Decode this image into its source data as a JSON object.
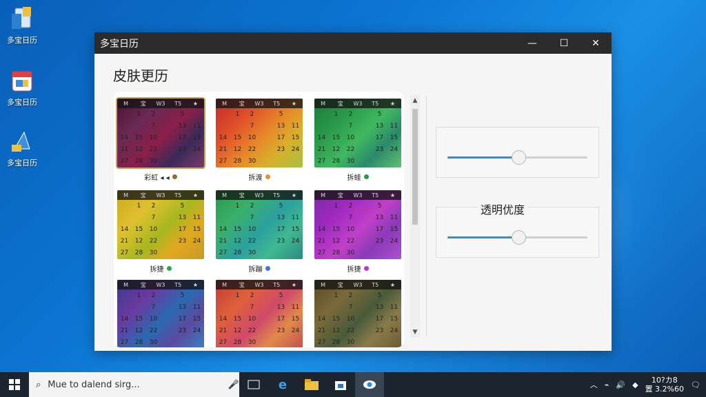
{
  "desktop": {
    "icons": [
      {
        "label": "多宝日历",
        "icon": "recycle-bin-icon"
      },
      {
        "label": "多宝日历",
        "icon": "calendar-app-icon"
      },
      {
        "label": "多宝日历",
        "icon": "network-icon"
      }
    ]
  },
  "window": {
    "title": "多宝日历",
    "controls": {
      "minimize": "—",
      "maximize": "☐",
      "close": "✕"
    },
    "heading": "皮肤更历",
    "skins": [
      {
        "label": "彩虹 ◂ ◂",
        "dot": "#8a6e2a",
        "selected": true,
        "colors": [
          "#4a1230",
          "#6a2a55",
          "#8a1f4a",
          "#3a2a5a",
          "#7a3a6a",
          "#a0506a"
        ]
      },
      {
        "label": "拆渡",
        "dot": "#f08a2a",
        "selected": false,
        "colors": [
          "#c02a2a",
          "#e0502a",
          "#e8882a",
          "#d8b02a",
          "#a8c040",
          "#e06a30"
        ]
      },
      {
        "label": "拆蛙",
        "dot": "#2a9a4a",
        "selected": false,
        "colors": [
          "#1a7a3a",
          "#2a9a4a",
          "#40b860",
          "#2a8a6a",
          "#60c070",
          "#1a6a4a"
        ]
      },
      {
        "label": "拆捷",
        "dot": "#2aa84a",
        "selected": false,
        "colors": [
          "#c8a820",
          "#e0c030",
          "#a8b820",
          "#e0a820",
          "#c89a28",
          "#b8c040"
        ]
      },
      {
        "label": "拆蹦",
        "dot": "#3a7ad8",
        "selected": false,
        "colors": [
          "#2a9a4a",
          "#3ab06a",
          "#2aa0a0",
          "#40b890",
          "#2a8a80",
          "#50c0a0"
        ]
      },
      {
        "label": "拆捷",
        "dot": "#c03ac0",
        "selected": false,
        "colors": [
          "#7a2aa0",
          "#a02ac0",
          "#c040c8",
          "#8a3ab8",
          "#b050d0",
          "#e060c0"
        ]
      },
      {
        "label": "—",
        "dot": "",
        "selected": false,
        "colors": [
          "#3a3a8a",
          "#6a3aa0",
          "#2a6ab0",
          "#5a4aa0",
          "#3a80c0",
          "#7a5ab0"
        ]
      },
      {
        "label": "—",
        "dot": "",
        "selected": false,
        "colors": [
          "#c03a3a",
          "#e0603a",
          "#d04a6a",
          "#e08a4a",
          "#c05050",
          "#e07a6a"
        ]
      },
      {
        "label": "—",
        "dot": "",
        "selected": false,
        "colors": [
          "#5a4a2a",
          "#7a6a3a",
          "#4a5a3a",
          "#8a7a4a",
          "#6a5a30",
          "#7a6a50"
        ]
      }
    ],
    "calendar": {
      "weekday_header": [
        "M",
        "宝",
        "W3",
        "T5",
        "★"
      ],
      "days": [
        [
          "",
          "1",
          "2",
          "",
          "5",
          ""
        ],
        [
          "",
          "",
          "7",
          "",
          "13",
          "11"
        ],
        [
          "14",
          "15",
          "10",
          "",
          "17",
          "15"
        ],
        [
          "21",
          "12",
          "22",
          "",
          "23",
          "24"
        ],
        [
          "27",
          "28",
          "30",
          "",
          "",
          ""
        ]
      ]
    },
    "sliders": [
      {
        "name": "slider-top",
        "label": "",
        "value": 0.5
      },
      {
        "name": "slider-transparency",
        "label": "透明优度",
        "value": 0.5
      }
    ]
  },
  "taskbar": {
    "search_placeholder": "Mue to dalend sirg...",
    "clock_time": "10?カ8",
    "clock_date": "置 3.2%60"
  }
}
